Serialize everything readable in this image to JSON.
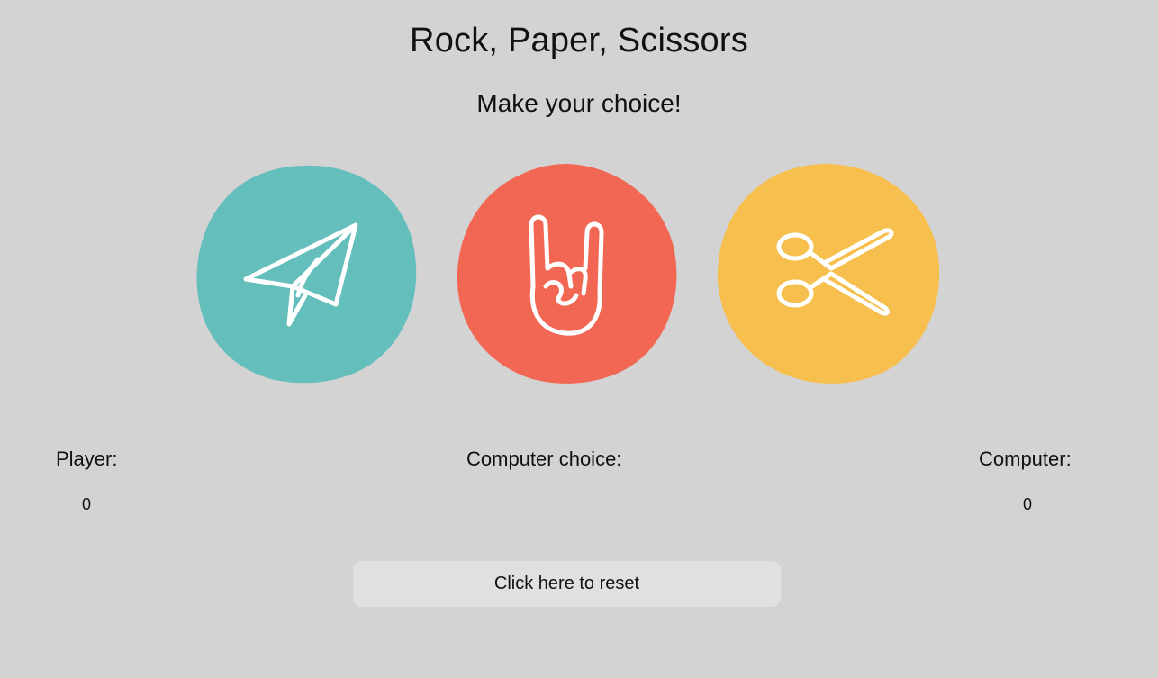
{
  "header": {
    "title": "Rock, Paper, Scissors",
    "subtitle": "Make your choice!"
  },
  "choices": [
    {
      "name": "paper",
      "icon": "paper-plane-icon",
      "color": "#64bebc"
    },
    {
      "name": "rock",
      "icon": "rock-hand-icon",
      "color": "#f26754"
    },
    {
      "name": "scissors",
      "icon": "scissors-icon",
      "color": "#f6bf4e"
    }
  ],
  "scoreboard": {
    "player_label": "Player:",
    "player_score": "0",
    "computer_choice_label": "Computer choice:",
    "computer_choice_value": "",
    "computer_label": "Computer:",
    "computer_score": "0"
  },
  "controls": {
    "reset_label": "Click here to reset"
  }
}
